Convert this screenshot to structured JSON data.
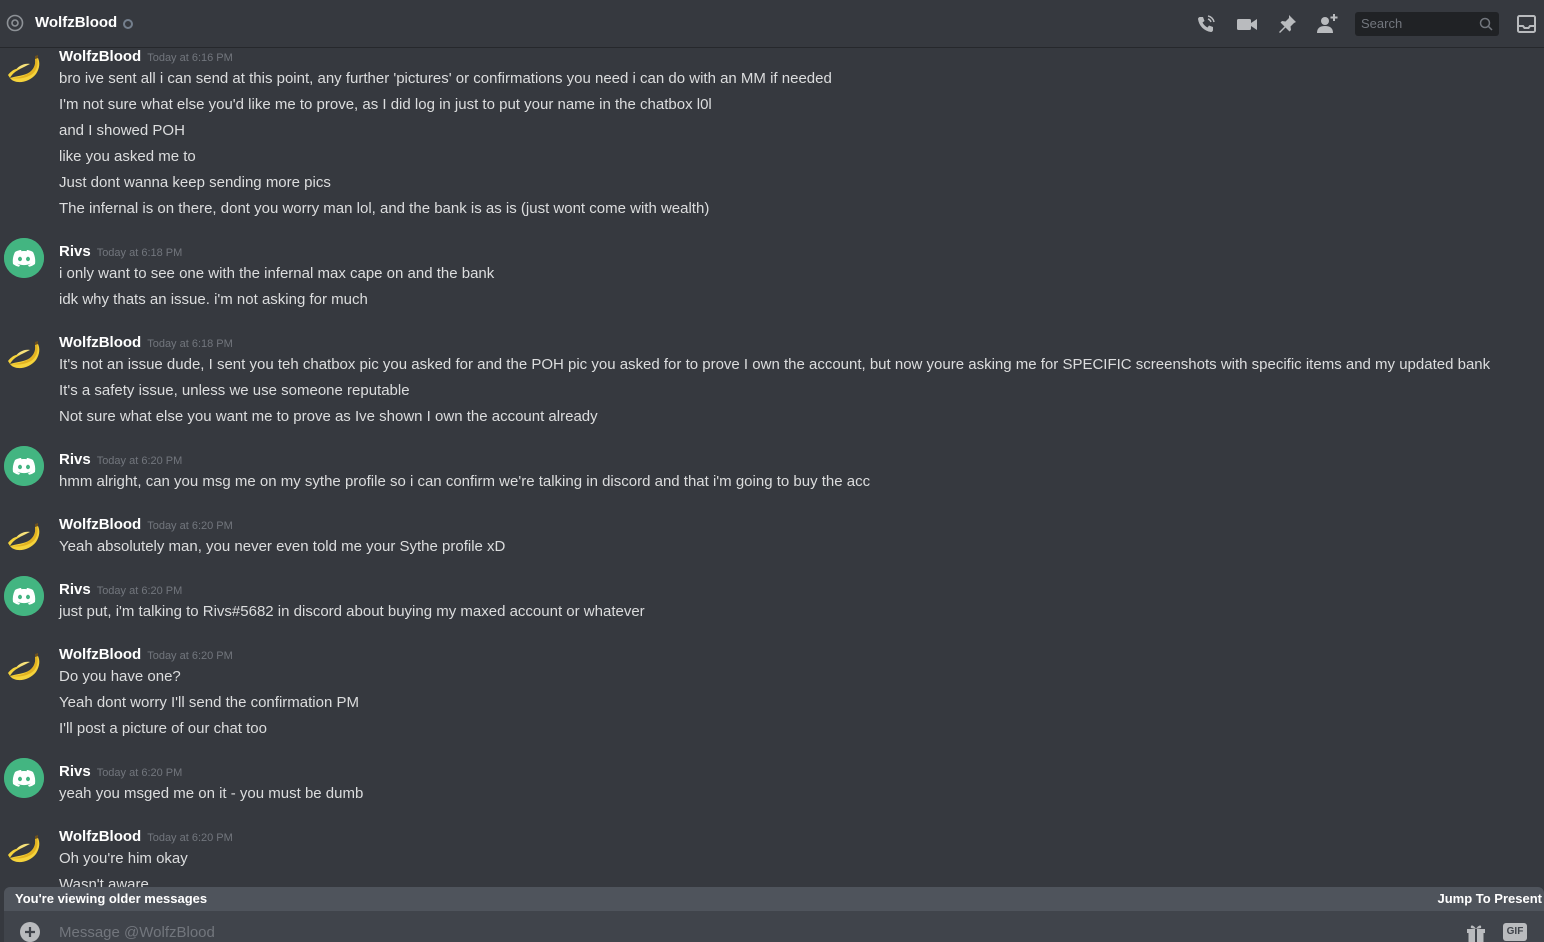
{
  "header": {
    "channel_name": "WolfzBlood",
    "search_placeholder": "Search"
  },
  "messages": [
    {
      "author": "WolfzBlood",
      "avatar": "banana",
      "timestamp": "Today at 6:16 PM",
      "lines": [
        "bro ive sent all i can send at this point, any further 'pictures' or confirmations you need i can do with an MM if needed",
        "I'm not sure what else you'd like me to prove, as I did log in just to put your name in the chatbox l0l",
        "and I showed POH",
        "like you asked me to",
        "Just dont wanna keep sending more pics",
        "The infernal is on there, dont you worry man lol, and the bank is as is (just wont come with wealth)"
      ]
    },
    {
      "author": "Rivs",
      "avatar": "discord",
      "timestamp": "Today at 6:18 PM",
      "lines": [
        "i only want to see one with the infernal max cape on and the bank",
        "idk why thats an issue. i'm not asking for much"
      ]
    },
    {
      "author": "WolfzBlood",
      "avatar": "banana",
      "timestamp": "Today at 6:18 PM",
      "lines": [
        "It's not an issue dude, I sent you teh chatbox pic you asked for and the POH pic you asked for to prove I own the account, but now youre asking me for SPECIFIC screenshots with specific items and my updated bank",
        "It's a safety issue, unless we use someone reputable",
        "Not sure what else you want me to prove as Ive shown I own the account already"
      ]
    },
    {
      "author": "Rivs",
      "avatar": "discord",
      "timestamp": "Today at 6:20 PM",
      "lines": [
        "hmm alright, can you msg me on my sythe profile so i can confirm we're talking in discord and that i'm going to buy the acc"
      ]
    },
    {
      "author": "WolfzBlood",
      "avatar": "banana",
      "timestamp": "Today at 6:20 PM",
      "lines": [
        "Yeah absolutely man, you never even told me your Sythe profile xD"
      ]
    },
    {
      "author": "Rivs",
      "avatar": "discord",
      "timestamp": "Today at 6:20 PM",
      "lines": [
        "just put, i'm talking to Rivs#5682 in discord about buying my maxed account or whatever"
      ]
    },
    {
      "author": "WolfzBlood",
      "avatar": "banana",
      "timestamp": "Today at 6:20 PM",
      "lines": [
        "Do you have one?",
        "Yeah dont worry I'll send the confirmation PM",
        "I'll post a picture of our chat too"
      ]
    },
    {
      "author": "Rivs",
      "avatar": "discord",
      "timestamp": "Today at 6:20 PM",
      "lines": [
        "yeah you msged me on it - you must be dumb"
      ]
    },
    {
      "author": "WolfzBlood",
      "avatar": "banana",
      "timestamp": "Today at 6:20 PM",
      "lines": [
        "Oh you're him okay",
        "Wasn't aware"
      ]
    }
  ],
  "older_bar": {
    "text": "You're viewing older messages",
    "jump_label": "Jump To Present"
  },
  "composer": {
    "placeholder": "Message @WolfzBlood",
    "gif_label": "GIF"
  },
  "icons": {
    "header": [
      "at-icon",
      "phone-call-icon",
      "video-call-icon",
      "pin-icon",
      "add-friend-icon",
      "search-icon",
      "inbox-icon"
    ],
    "composer": [
      "plus-circle-icon",
      "gift-icon"
    ]
  },
  "colors": {
    "background": "#36393f",
    "online_green": "#43b581",
    "timestamp_gray": "#72767d",
    "message_text": "#dcddde",
    "older_bar": "#4f545c"
  }
}
